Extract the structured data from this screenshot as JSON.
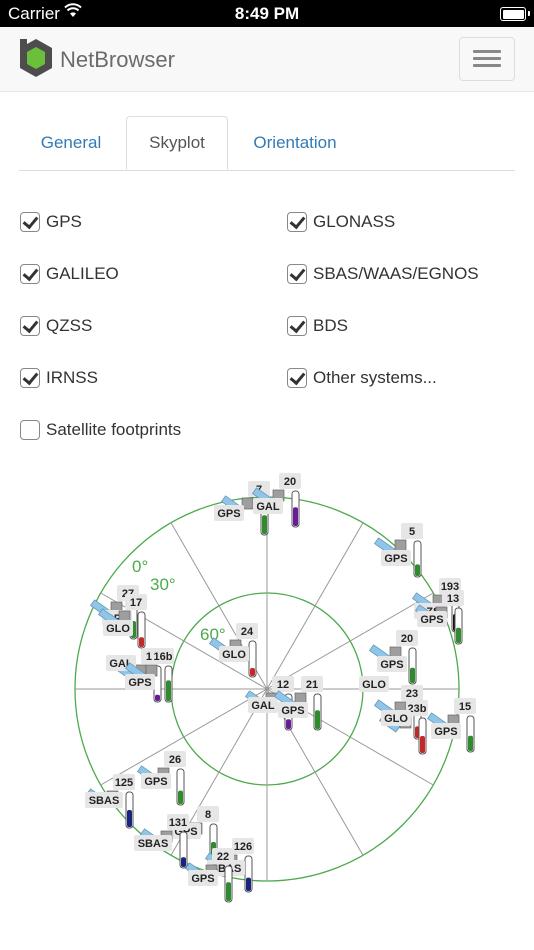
{
  "status": {
    "carrier": "Carrier",
    "time": "8:49 PM"
  },
  "app": {
    "brand": "NetBrowser"
  },
  "tabs": [
    {
      "label": "General",
      "active": false
    },
    {
      "label": "Skyplot",
      "active": true
    },
    {
      "label": "Orientation",
      "active": false
    }
  ],
  "options": [
    {
      "label": "GPS",
      "checked": true
    },
    {
      "label": "GLONASS",
      "checked": true
    },
    {
      "label": "GALILEO",
      "checked": true
    },
    {
      "label": "SBAS/WAAS/EGNOS",
      "checked": true
    },
    {
      "label": "QZSS",
      "checked": true
    },
    {
      "label": "BDS",
      "checked": true
    },
    {
      "label": "IRNSS",
      "checked": true
    },
    {
      "label": "Other systems...",
      "checked": true
    }
  ],
  "footprints": {
    "label": "Satellite footprints",
    "checked": false
  },
  "skyplot": {
    "elevation_labels": [
      "0°",
      "30°",
      "60°"
    ],
    "colors": {
      "grid": "#4caa4c",
      "gps": "#2e8b2e",
      "glo": "#c62828",
      "gal": "#6a1b9a",
      "sbas": "#1a237e",
      "qzss": "#111111"
    },
    "satellites": [
      {
        "id": "7",
        "system": "GPS",
        "level": 0.55,
        "color": "gps"
      },
      {
        "id": "20",
        "system": "GAL",
        "level": 0.55,
        "color": "gal"
      },
      {
        "id": "5",
        "system": "GPS",
        "level": 0.35,
        "color": "gps"
      },
      {
        "id": "193",
        "system": "QZS",
        "level": 0.5,
        "color": "qzss"
      },
      {
        "id": "13",
        "system": "GPS",
        "level": 0.45,
        "color": "gps"
      },
      {
        "id": "27",
        "system": "GPS",
        "level": 0.5,
        "color": "gps"
      },
      {
        "id": "17",
        "system": "GLO",
        "level": 0.3,
        "color": "glo"
      },
      {
        "id": "16",
        "system": "GAL",
        "level": 0.2,
        "color": "gal"
      },
      {
        "id": "16b",
        "system": "GPS",
        "level": 0.6,
        "color": "gps"
      },
      {
        "id": "24",
        "system": "GLO",
        "level": 0.25,
        "color": "glo"
      },
      {
        "id": "20b",
        "system": "GPS",
        "level": 0.45,
        "color": "gps"
      },
      {
        "id": "23",
        "system": "GLO",
        "level": 0.35,
        "color": "glo"
      },
      {
        "id": "23b",
        "system": "GLO",
        "level": 0.5,
        "color": "glo"
      },
      {
        "id": "12",
        "system": "GAL",
        "level": 0.3,
        "color": "gal"
      },
      {
        "id": "21",
        "system": "GPS",
        "level": 0.55,
        "color": "gps"
      },
      {
        "id": "15",
        "system": "GPS",
        "level": 0.45,
        "color": "gps"
      },
      {
        "id": "26",
        "system": "GPS",
        "level": 0.4,
        "color": "gps"
      },
      {
        "id": "125",
        "system": "SBAS",
        "level": 0.5,
        "color": "sbas"
      },
      {
        "id": "8",
        "system": "GPS",
        "level": 0.5,
        "color": "gps"
      },
      {
        "id": "131",
        "system": "SBAS",
        "level": 0.3,
        "color": "sbas"
      },
      {
        "id": "126",
        "system": "SBAS",
        "level": 0.4,
        "color": "sbas"
      },
      {
        "id": "22",
        "system": "GPS",
        "level": 0.55,
        "color": "gps"
      }
    ],
    "tags": {
      "7": "7",
      "20": "20",
      "5": "5",
      "193": "193",
      "13": "13",
      "27": "27",
      "17": "17",
      "16": "16",
      "24": "24",
      "20b": "20",
      "23": "23",
      "12": "12",
      "21": "21",
      "15": "15",
      "26": "26",
      "125": "125",
      "8": "8",
      "13x": "13",
      "126": "126",
      "22": "22",
      "GPS": "GPS",
      "GAL": "GAL",
      "GLO": "GLO",
      "QZS": "QZS",
      "SBAS": "SBAS"
    }
  }
}
